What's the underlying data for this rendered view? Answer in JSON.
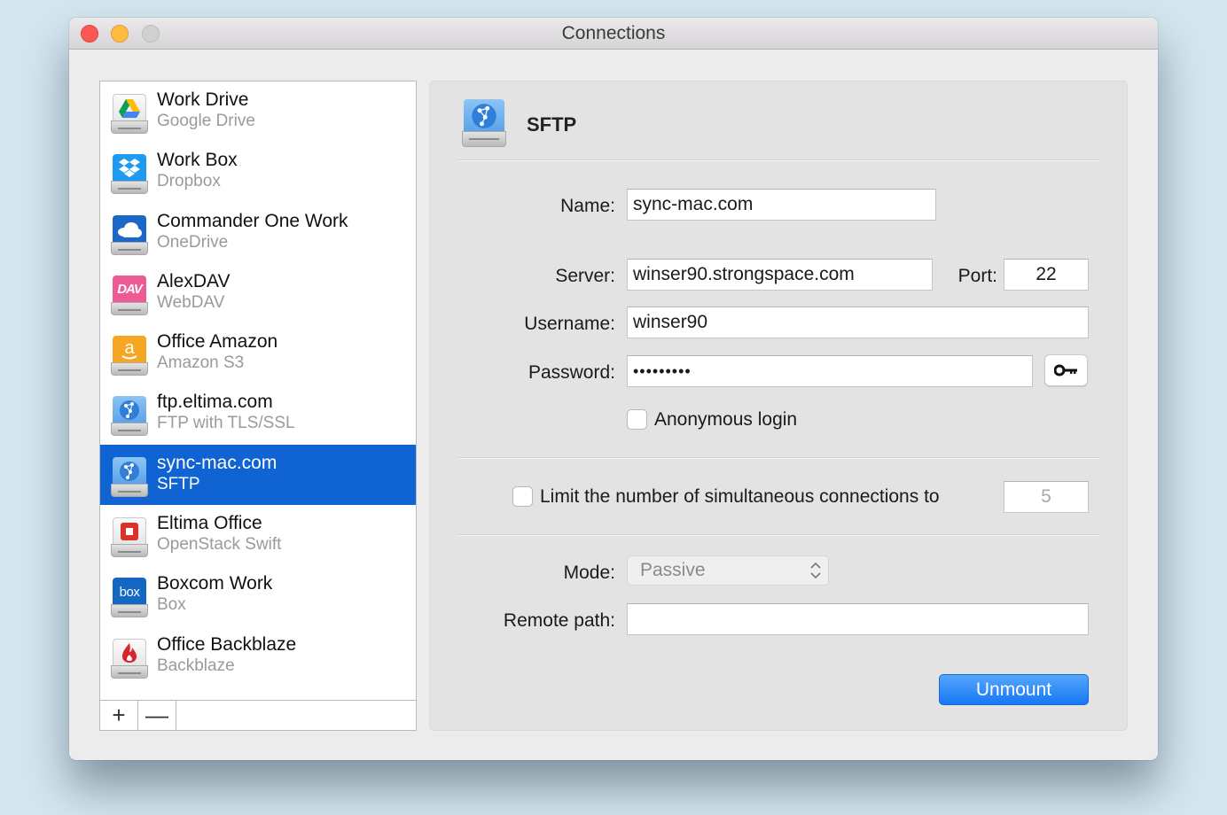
{
  "window": {
    "title": "Connections",
    "controls": {
      "close": "close-button",
      "minimize": "minimize-button",
      "zoom": "zoom-button"
    }
  },
  "sidebar": {
    "items": [
      {
        "name": "Work Drive",
        "type": "Google Drive",
        "icon": "google-drive-icon",
        "selected": false
      },
      {
        "name": "Work Box",
        "type": "Dropbox",
        "icon": "dropbox-icon",
        "selected": false
      },
      {
        "name": "Commander One Work",
        "type": "OneDrive",
        "icon": "onedrive-icon",
        "selected": false
      },
      {
        "name": "AlexDAV",
        "type": "WebDAV",
        "icon": "webdav-icon",
        "selected": false
      },
      {
        "name": "Office Amazon",
        "type": "Amazon S3",
        "icon": "amazon-s3-icon",
        "selected": false
      },
      {
        "name": "ftp.eltima.com",
        "type": "FTP with TLS/SSL",
        "icon": "network-globe-icon",
        "selected": false
      },
      {
        "name": "sync-mac.com",
        "type": "SFTP",
        "icon": "network-globe-icon",
        "selected": true
      },
      {
        "name": "Eltima Office",
        "type": "OpenStack Swift",
        "icon": "openstack-icon",
        "selected": false
      },
      {
        "name": "Boxcom Work",
        "type": "Box",
        "icon": "box-icon",
        "selected": false
      },
      {
        "name": "Office Backblaze",
        "type": "Backblaze",
        "icon": "backblaze-icon",
        "selected": false
      }
    ],
    "add_label": "+",
    "remove_label": "—"
  },
  "details": {
    "header_title": "SFTP",
    "header_icon": "network-globe-icon",
    "name_label": "Name:",
    "name_value": "sync-mac.com",
    "server_label": "Server:",
    "server_value": "winser90.strongspace.com",
    "port_label": "Port:",
    "port_value": "22",
    "username_label": "Username:",
    "username_value": "winser90",
    "password_label": "Password:",
    "password_value": "•••••••••",
    "keychain_icon": "key-icon",
    "anonymous_label": "Anonymous login",
    "anonymous_checked": false,
    "limit_label": "Limit the number of simultaneous connections to",
    "limit_checked": false,
    "limit_value": "5",
    "mode_label": "Mode:",
    "mode_value": "Passive",
    "remote_path_label": "Remote path:",
    "remote_path_value": "",
    "unmount_label": "Unmount"
  },
  "colors": {
    "selection": "#0f63d2",
    "primary_button": "#1677f5",
    "close": "#fc5753",
    "minimize": "#fdbc40"
  }
}
